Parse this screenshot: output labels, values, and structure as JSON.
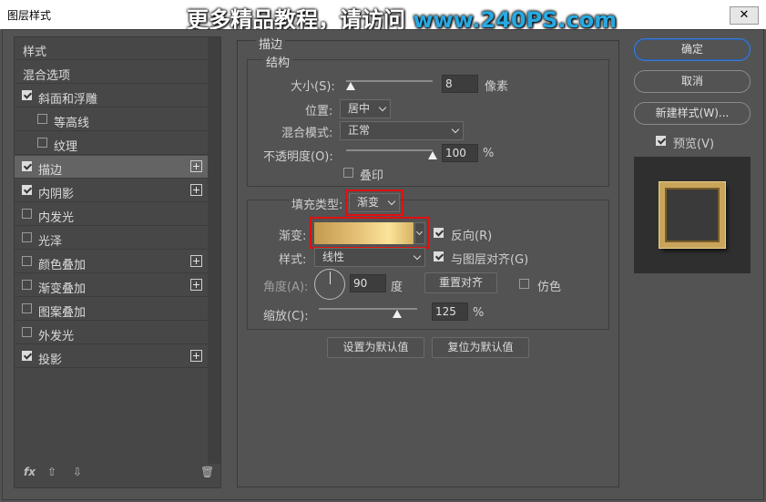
{
  "window": {
    "title": "图层样式",
    "close_label": "✕"
  },
  "watermark": {
    "text": "更多精品教程，请访问 ",
    "url": "www.240PS.com"
  },
  "sidebar": {
    "items": [
      {
        "label": "样式",
        "check": null,
        "plus": false
      },
      {
        "label": "混合选项",
        "check": null,
        "plus": false
      },
      {
        "label": "斜面和浮雕",
        "check": true,
        "plus": false
      },
      {
        "label": "等高线",
        "check": false,
        "plus": false,
        "indent": true
      },
      {
        "label": "纹理",
        "check": false,
        "plus": false,
        "indent": true
      },
      {
        "label": "描边",
        "check": true,
        "plus": true,
        "selected": true
      },
      {
        "label": "内阴影",
        "check": true,
        "plus": true
      },
      {
        "label": "内发光",
        "check": false,
        "plus": false
      },
      {
        "label": "光泽",
        "check": false,
        "plus": false
      },
      {
        "label": "颜色叠加",
        "check": false,
        "plus": true
      },
      {
        "label": "渐变叠加",
        "check": false,
        "plus": true
      },
      {
        "label": "图案叠加",
        "check": false,
        "plus": false
      },
      {
        "label": "外发光",
        "check": false,
        "plus": false
      },
      {
        "label": "投影",
        "check": true,
        "plus": true
      }
    ],
    "footer": {
      "fx": "fx",
      "up": "⇧",
      "down": "⇩",
      "trash": "🗑"
    }
  },
  "stroke": {
    "section_title": "描边",
    "structure": {
      "title": "结构",
      "size_label": "大小(S):",
      "size_value": "8",
      "size_unit": "像素",
      "position_label": "位置:",
      "position_value": "居中",
      "blend_label": "混合模式:",
      "blend_value": "正常",
      "opacity_label": "不透明度(O):",
      "opacity_value": "100",
      "opacity_unit": "%",
      "overprint_label": "叠印"
    },
    "fill": {
      "type_label": "填充类型:",
      "type_value": "渐变",
      "gradient_label": "渐变:",
      "reverse_label": "反向(R)",
      "style_label": "样式:",
      "style_value": "线性",
      "align_label": "与图层对齐(G)",
      "angle_label": "角度(A):",
      "angle_value": "90",
      "angle_unit": "度",
      "reset_align_label": "重置对齐",
      "dither_label": "仿色",
      "scale_label": "缩放(C):",
      "scale_value": "125",
      "scale_unit": "%"
    },
    "set_default_label": "设置为默认值",
    "reset_default_label": "复位为默认值"
  },
  "right": {
    "ok_label": "确定",
    "cancel_label": "取消",
    "new_style_label": "新建样式(W)...",
    "preview_label": "预览(V)"
  },
  "colors": {
    "accent": "#3b7bd4",
    "highlight": "#e01010",
    "gold": "#c9a55c"
  }
}
